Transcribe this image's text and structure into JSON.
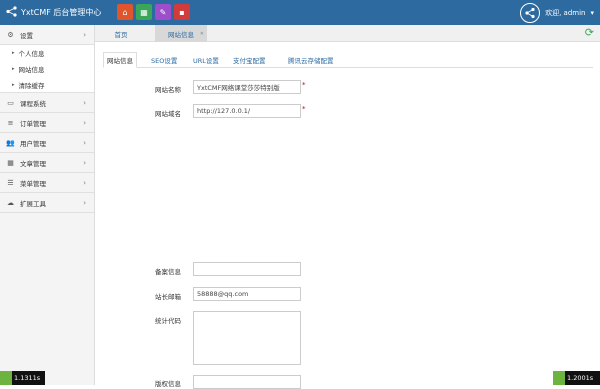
{
  "header": {
    "app_title": "YxtCMF 后台管理中心",
    "welcome": "欢迎,",
    "username": "admin"
  },
  "quick_buttons": [
    {
      "icon": "home-icon",
      "color": "#e0552b"
    },
    {
      "icon": "grid-icon",
      "color": "#3aa65a"
    },
    {
      "icon": "pencil-icon",
      "color": "#9d4ecb"
    },
    {
      "icon": "trash-icon",
      "color": "#d23b3b"
    }
  ],
  "sidebar": {
    "items": [
      {
        "label": "设置",
        "icon": "gear-icon"
      },
      {
        "label": "课程系统",
        "icon": "monitor-icon"
      },
      {
        "label": "订单管理",
        "icon": "list-icon"
      },
      {
        "label": "用户管理",
        "icon": "users-icon"
      },
      {
        "label": "文章管理",
        "icon": "grid-icon"
      },
      {
        "label": "菜单管理",
        "icon": "menu-icon"
      },
      {
        "label": "扩展工具",
        "icon": "cloud-icon"
      }
    ],
    "submenu": [
      "个人信息",
      "网站信息",
      "清除缓存"
    ]
  },
  "page_tabs": [
    {
      "label": "首页"
    },
    {
      "label": "网站信息"
    }
  ],
  "sub_tabs": [
    "网站信息",
    "SEO设置",
    "URL设置",
    "支付宝配置",
    "腾讯云存储配置"
  ],
  "form": {
    "site_name_label": "网站名称",
    "site_name_value": "YxtCMF网络课堂莎莎特别版",
    "domain_label": "网站域名",
    "domain_value": "http://127.0.0.1/",
    "icp_label": "备案信息",
    "icp_value": "",
    "email_label": "站长邮箱",
    "email_value": "58888@qq.com",
    "stats_label": "统计代码",
    "copyright_label": "版权信息"
  },
  "counters": {
    "left": "1.1311s",
    "right": "1.2001s"
  },
  "colors": {
    "topbar": "#2c6aa0",
    "link": "#2c6aa0",
    "required": "#cc0000"
  }
}
